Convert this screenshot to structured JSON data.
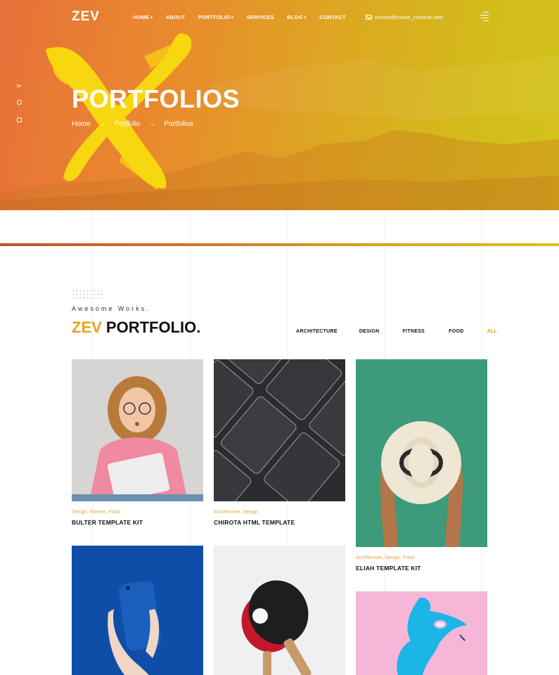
{
  "header": {
    "logo": "ZEV",
    "nav": [
      {
        "label": "HOME",
        "has_submenu": true
      },
      {
        "label": "ABOUT",
        "has_submenu": false
      },
      {
        "label": "PORTFOLIO",
        "has_submenu": true
      },
      {
        "label": "SERVICES",
        "has_submenu": false
      },
      {
        "label": "BLOG",
        "has_submenu": true
      },
      {
        "label": "CONTACT",
        "has_submenu": false
      }
    ],
    "email": "contact@zview_creative.com",
    "menu_icon": "hamburger-icon"
  },
  "social": [
    "be",
    "pinterest-icon",
    "instagram-icon"
  ],
  "hero": {
    "title": "PORTFOLIOS",
    "breadcrumb": [
      "Home",
      "Portfolio",
      "Portfolios"
    ]
  },
  "portfolio": {
    "subtitle": "Awesome Works.",
    "title_accent": "ZEV",
    "title_rest": "PORTFOLIO.",
    "filters": [
      "ARCHITECTURE",
      "DESIGN",
      "FITNESS",
      "FOOD",
      "ALL"
    ],
    "active_filter": "ALL",
    "items": [
      {
        "categories": "Design, Fitness, Food",
        "title": "BULTER TEMPLATE KIT"
      },
      {
        "categories": "Architecture, Design",
        "title": "CHIROTA HTML TEMPLATE"
      },
      {
        "categories": "Architecture, Design, Food",
        "title": "ELIAH TEMPLATE KIT"
      }
    ]
  },
  "colors": {
    "accent": "#e9a21a",
    "hero_start": "#e8703a",
    "hero_end": "#d4c31c",
    "brush": "#f7d70f"
  }
}
